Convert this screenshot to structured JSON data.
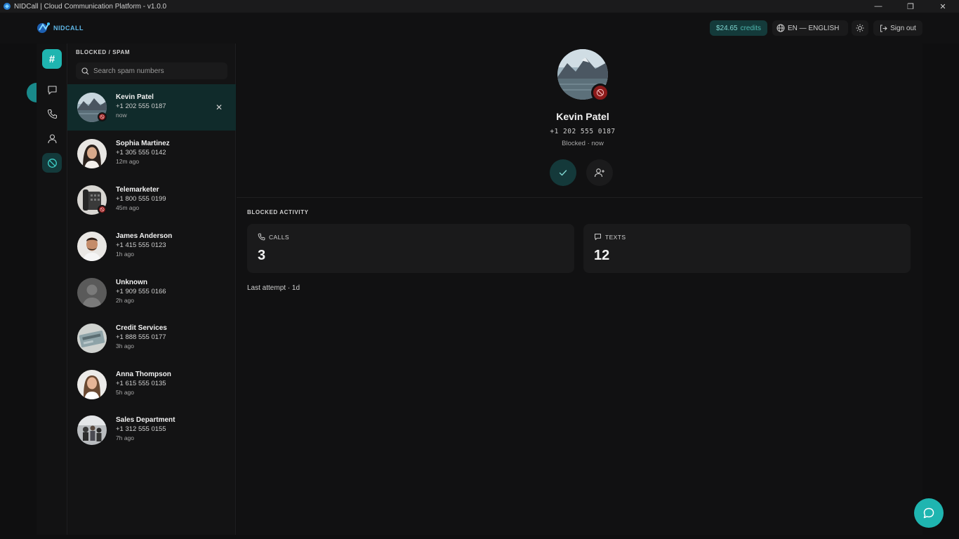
{
  "window": {
    "title": "NIDCall | Cloud Communication Platform - v1.0.0",
    "minimize": "—",
    "maximize": "❐",
    "close": "✕"
  },
  "header": {
    "logo_text": "NIDCALL",
    "credits_amount": "$24.65",
    "credits_unit": "credits",
    "language": "EN — ENGLISH",
    "signout": "Sign out"
  },
  "rail": {
    "brand_symbol": "#"
  },
  "list": {
    "heading": "BLOCKED / SPAM",
    "search_placeholder": "Search spam numbers",
    "contacts": [
      {
        "name": "Kevin Patel",
        "phone": "+1 202 555 0187",
        "time": "now"
      },
      {
        "name": "Sophia Martinez",
        "phone": "+1 305 555 0142",
        "time": "12m ago"
      },
      {
        "name": "Telemarketer",
        "phone": "+1 800 555 0199",
        "time": "45m ago"
      },
      {
        "name": "James Anderson",
        "phone": "+1 415 555 0123",
        "time": "1h ago"
      },
      {
        "name": "Unknown",
        "phone": "+1 909 555 0166",
        "time": "2h ago"
      },
      {
        "name": "Credit Services",
        "phone": "+1 888 555 0177",
        "time": "3h ago"
      },
      {
        "name": "Anna Thompson",
        "phone": "+1 615 555 0135",
        "time": "5h ago"
      },
      {
        "name": "Sales Department",
        "phone": "+1 312 555 0155",
        "time": "7h ago"
      }
    ]
  },
  "detail": {
    "name": "Kevin Patel",
    "phone": "+1 202 555 0187",
    "status": "Blocked · now",
    "section_label": "BLOCKED ACTIVITY",
    "calls_label": "CALLS",
    "calls_value": "3",
    "texts_label": "TEXTS",
    "texts_value": "12",
    "last_attempt": "Last attempt · 1d"
  },
  "colors": {
    "accent": "#1fb5b0",
    "blocked": "#8b1a1a",
    "selected_row": "#102b2b"
  }
}
